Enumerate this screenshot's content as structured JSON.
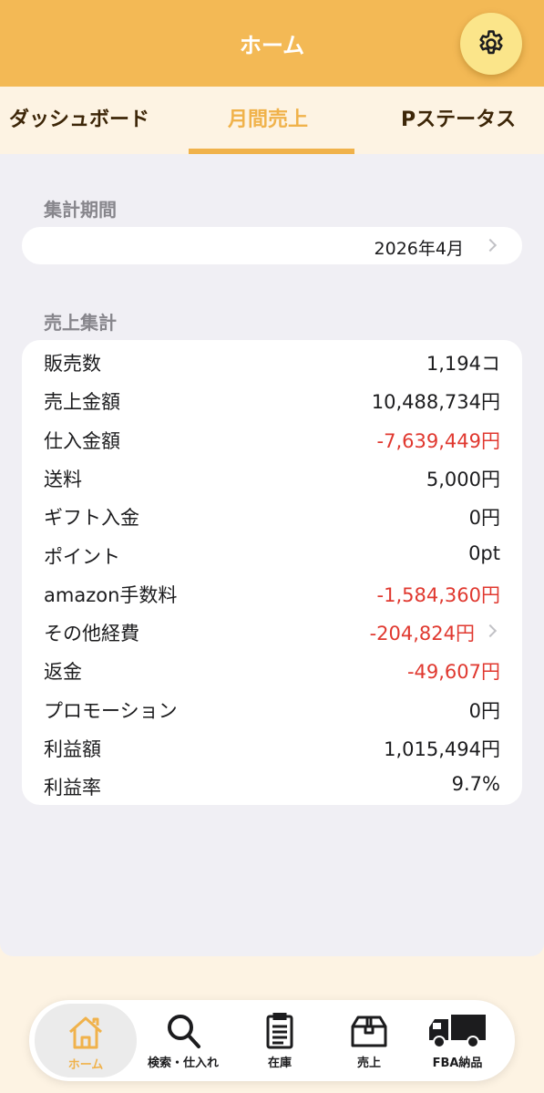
{
  "header": {
    "title": "ホーム",
    "settings_icon": "gear-icon"
  },
  "tabs": [
    {
      "label": "ダッシュボード",
      "active": false
    },
    {
      "label": "月間売上",
      "active": true
    },
    {
      "label": "Pステータス",
      "active": false
    }
  ],
  "period": {
    "section_label": "集計期間",
    "value": "2026年4月"
  },
  "summary": {
    "section_label": "売上集計",
    "rows": [
      {
        "label": "販売数",
        "value": "1,194コ",
        "negative": false,
        "chevron": false
      },
      {
        "label": "売上金額",
        "value": "10,488,734円",
        "negative": false,
        "chevron": false
      },
      {
        "label": "仕入金額",
        "value": "-7,639,449円",
        "negative": true,
        "chevron": false
      },
      {
        "label": "送料",
        "value": "5,000円",
        "negative": false,
        "chevron": false
      },
      {
        "label": "ギフト入金",
        "value": "0円",
        "negative": false,
        "chevron": false
      },
      {
        "label": "ポイント",
        "value": "0pt",
        "negative": false,
        "chevron": false
      },
      {
        "label": "amazon手数料",
        "value": "-1,584,360円",
        "negative": true,
        "chevron": false
      },
      {
        "label": "その他経費",
        "value": "-204,824円",
        "negative": true,
        "chevron": true
      },
      {
        "label": "返金",
        "value": "-49,607円",
        "negative": true,
        "chevron": false
      },
      {
        "label": "プロモーション",
        "value": "0円",
        "negative": false,
        "chevron": false
      },
      {
        "label": "利益額",
        "value": "1,015,494円",
        "negative": false,
        "chevron": false
      },
      {
        "label": "利益率",
        "value": "9.7%",
        "negative": false,
        "chevron": false
      }
    ]
  },
  "tabbar": [
    {
      "label": "ホーム",
      "icon": "home-icon",
      "active": true
    },
    {
      "label": "検索・仕入れ",
      "icon": "search-icon",
      "active": false
    },
    {
      "label": "在庫",
      "icon": "clipboard-icon",
      "active": false
    },
    {
      "label": "売上",
      "icon": "box-icon",
      "active": false
    },
    {
      "label": "FBA納品",
      "icon": "truck-icon",
      "active": false
    }
  ],
  "colors": {
    "header": "#f3b955",
    "accent": "#f0b24b",
    "negative": "#e0382f",
    "background": "#f0eff4"
  }
}
